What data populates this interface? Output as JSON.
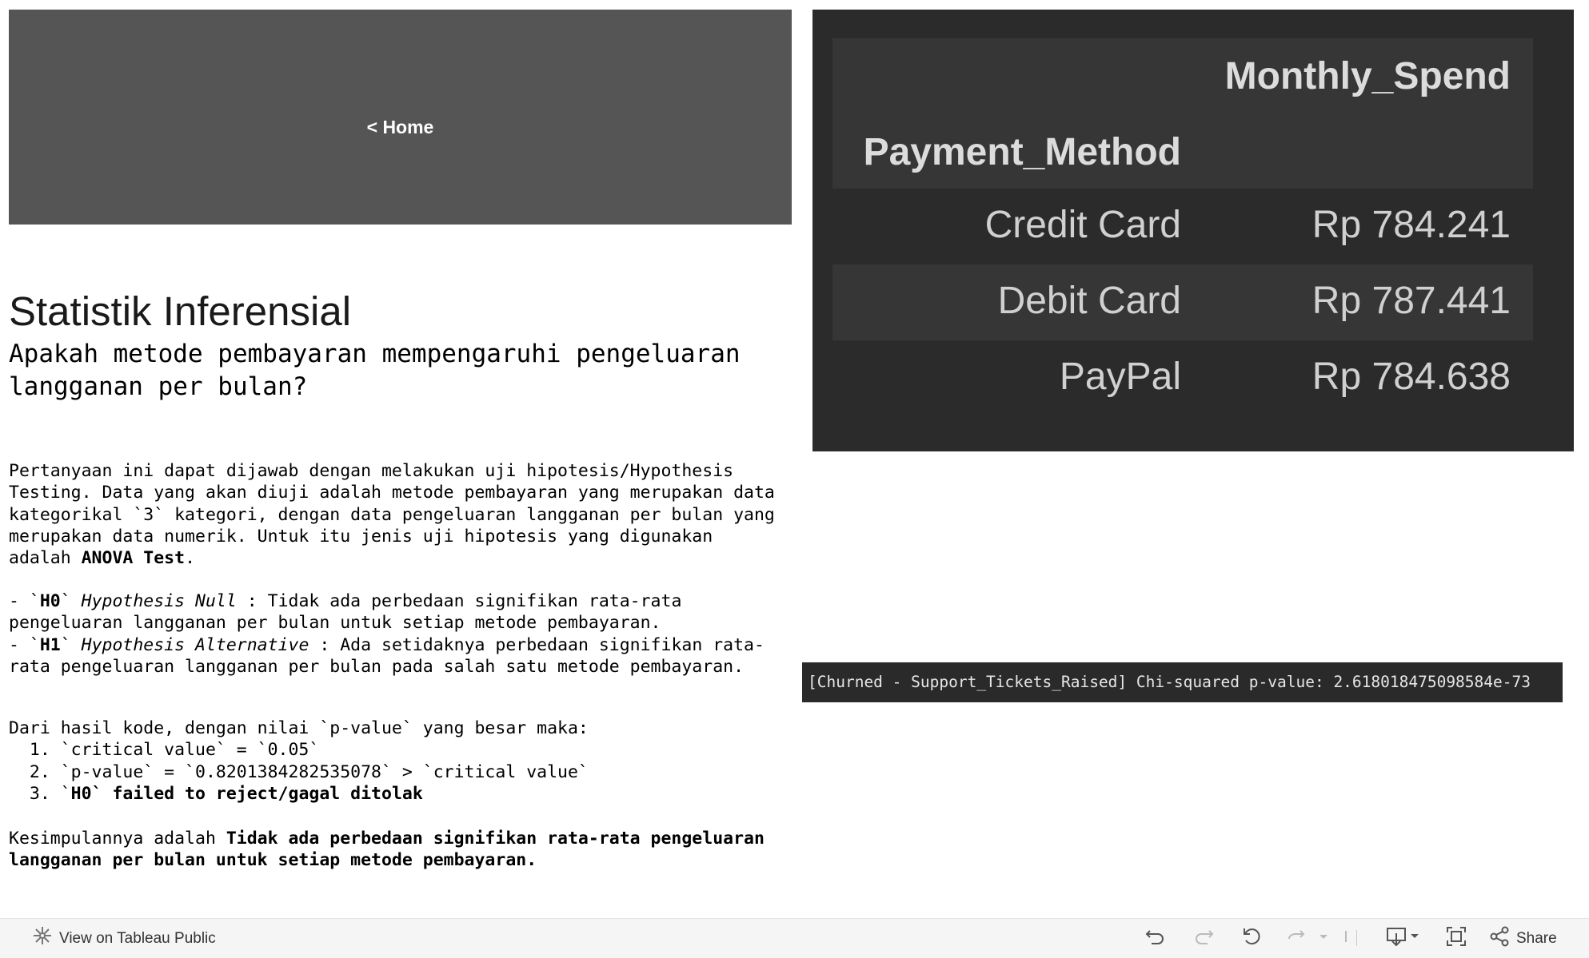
{
  "nav": {
    "home_label": "< Home"
  },
  "content": {
    "title": "Statistik Inferensial",
    "subtitle": "Apakah metode pembayaran mempengaruhi pengeluaran langganan per bulan?",
    "intro_lines": [
      "Pertanyaan ini dapat dijawab dengan melakukan uji hipotesis/Hypothesis",
      "Testing. Data yang akan diuji adalah metode pembayaran yang merupakan data",
      "kategorikal `3` kategori, dengan data pengeluaran langganan per bulan yang",
      "merupakan data numerik. Untuk itu jenis uji hipotesis yang digunakan",
      "adalah "
    ],
    "intro_bold": "ANOVA Test",
    "intro_end": ".",
    "h0_prefix": "- `",
    "h0_code": "H0",
    "h0_after_code": "` ",
    "h0_italic": "Hypothesis Null",
    "h0_text": " : Tidak ada perbedaan signifikan rata-rata",
    "h0_line2": "pengeluaran langganan per bulan untuk setiap metode pembayaran.",
    "h1_prefix": "- `",
    "h1_code": "H1",
    "h1_after_code": "` ",
    "h1_italic": "Hypothesis Alternative",
    "h1_text": " : Ada setidaknya perbedaan signifikan rata-",
    "h1_line2": "rata pengeluaran langganan per bulan pada salah satu metode pembayaran.",
    "result_intro": "Dari hasil kode, dengan nilai `p-value` yang besar maka:",
    "result_items": [
      "  1. `critical value` = `0.05`",
      "  2. `p-value` = `0.8201384282535078` > `critical value`"
    ],
    "result_item3_prefix": "  3. `",
    "result_item3_code": "H0",
    "result_item3_rest": "` failed to reject/gagal ditolak",
    "conclusion_prefix": "Kesimpulannya adalah ",
    "conclusion_bold_line1": "Tidak ada perbedaan signifikan rata-rata pengeluaran",
    "conclusion_bold_line2": "langganan per bulan untuk setiap metode pembayaran."
  },
  "table": {
    "value_header": "Monthly_Spend",
    "row_header": "Payment_Method",
    "rows": [
      {
        "method": "Credit Card",
        "spend": "Rp 784.241"
      },
      {
        "method": "Debit Card",
        "spend": "Rp 787.441"
      },
      {
        "method": "PayPal",
        "spend": "Rp 784.638"
      }
    ]
  },
  "console": {
    "text": "[Churned - Support_Tickets_Raised] Chi-squared p-value: 2.618018475098584e-73"
  },
  "toolbar": {
    "view_label": "View on Tableau Public",
    "share_label": "Share",
    "icons": [
      "tableau-icon",
      "undo-icon",
      "redo-icon",
      "revert-icon",
      "refresh-icon",
      "pause-icon",
      "download-icon",
      "fullscreen-icon",
      "share-icon"
    ]
  },
  "colors": {
    "home_panel": "#555555",
    "table_bg": "#2b2b2b",
    "table_band": "#363636",
    "console_bg": "#2a2a2a",
    "toolbar_bg": "#f5f5f5"
  }
}
